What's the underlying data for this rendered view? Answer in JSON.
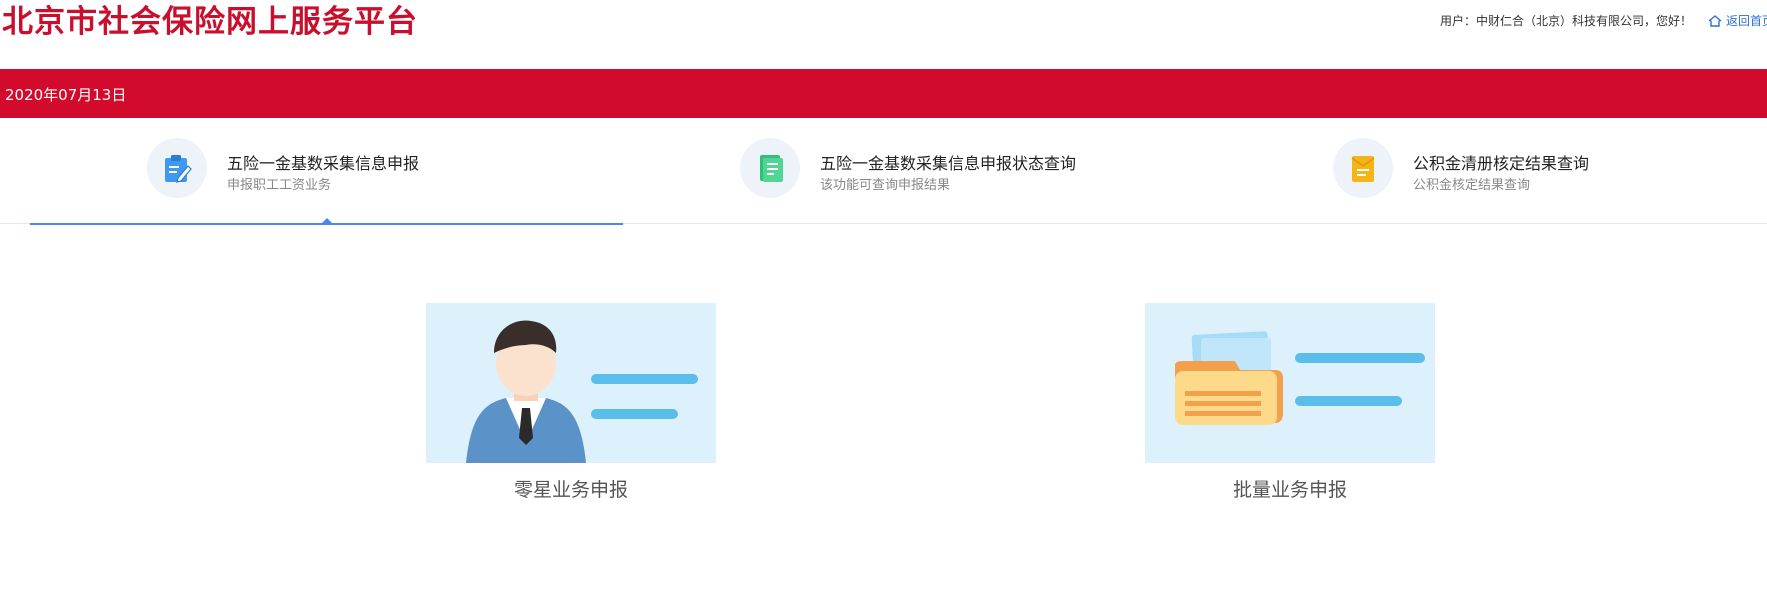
{
  "header": {
    "site_title": "北京市社会保险网上服务平台",
    "user_info": "用户：中财仁合（北京）科技有限公司，您好！",
    "home_link": "返回首页",
    "brand_color": "#c8102e"
  },
  "banner": {
    "date": "2020年07月13日",
    "color": "#d20a2b"
  },
  "tabs": [
    {
      "title": "五险一金基数采集信息申报",
      "subtitle": "申报职工工资业务",
      "icon": "edit-form-icon",
      "active": true
    },
    {
      "title": "五险一金基数采集信息申报状态查询",
      "subtitle": "该功能可查询申报结果",
      "icon": "document-search-icon",
      "active": false
    },
    {
      "title": "公积金清册核定结果查询",
      "subtitle": "公积金核定结果查询",
      "icon": "envelope-document-icon",
      "active": false
    }
  ],
  "cards": [
    {
      "label": "零星业务申报",
      "illustration": "person-illustration"
    },
    {
      "label": "批量业务申报",
      "illustration": "folder-illustration"
    }
  ],
  "colors": {
    "tab_accent": "#4a87e6",
    "card_bg": "#ddf1fc",
    "line_color": "#5bbde9"
  }
}
